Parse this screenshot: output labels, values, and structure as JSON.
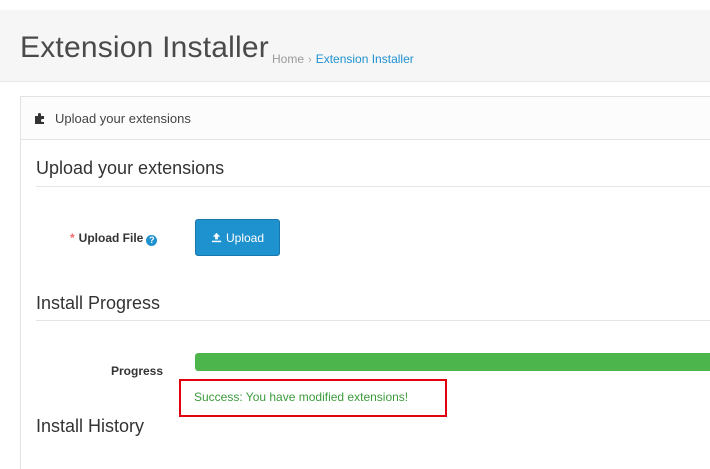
{
  "header": {
    "title": "Extension Installer",
    "breadcrumb": [
      {
        "label": "Home"
      },
      {
        "label": "Extension Installer"
      }
    ],
    "breadcrumb_separator": "›"
  },
  "panel": {
    "heading": "Upload your extensions",
    "icon": "puzzle-icon"
  },
  "upload_section": {
    "title": "Upload your extensions",
    "field_required_mark": "*",
    "field_label": "Upload File",
    "help_icon": "question-circle-icon",
    "button_label": "Upload",
    "button_icon": "upload-icon"
  },
  "progress_section": {
    "title": "Install Progress",
    "label": "Progress",
    "percent": 100,
    "status_text": "Success: You have modified extensions!"
  },
  "history_section": {
    "title": "Install History"
  },
  "colors": {
    "accent": "#1e91cf",
    "success": "#4cb64c",
    "success_text": "#3c9b3c",
    "highlight_border": "#e3000f",
    "required": "#f56b6b"
  }
}
